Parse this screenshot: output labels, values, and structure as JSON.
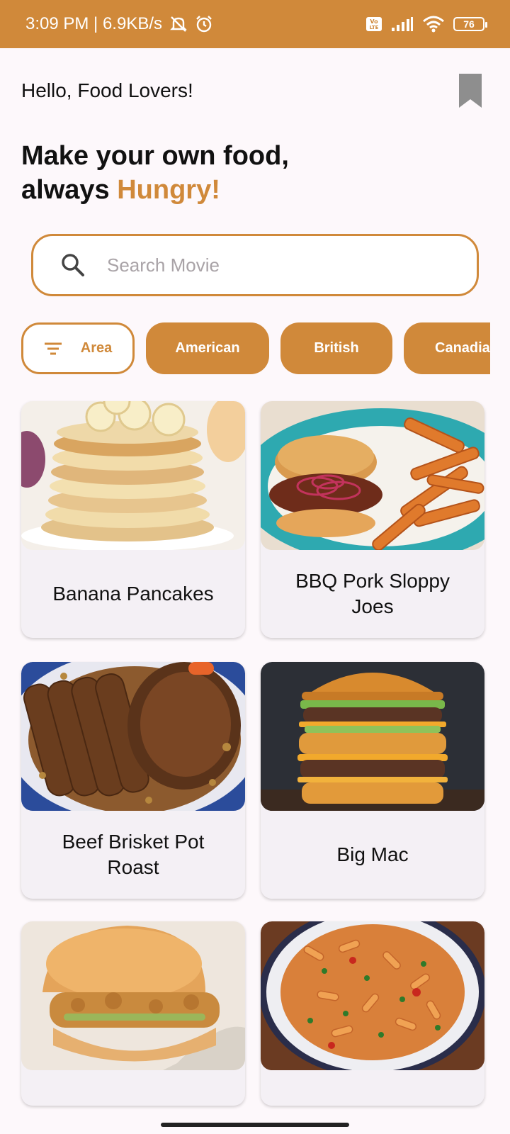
{
  "status_bar": {
    "time_speed": "3:09 PM | 6.9KB/s",
    "battery": "76",
    "icons": [
      "mute-icon",
      "alarm-icon",
      "volte-icon",
      "signal-icon",
      "wifi-icon",
      "battery-icon"
    ]
  },
  "header": {
    "greeting": "Hello, Food Lovers!",
    "headline_line1": "Make your own food,",
    "headline_line2_prefix": "always ",
    "headline_accent": "Hungry!"
  },
  "search": {
    "placeholder": "Search Movie",
    "value": ""
  },
  "filters": {
    "filter_label": "Area",
    "chips": [
      "American",
      "British",
      "Canadian"
    ]
  },
  "meals": [
    {
      "name": "Banana Pancakes"
    },
    {
      "name": "BBQ Pork Sloppy Joes"
    },
    {
      "name": "Beef Brisket Pot Roast"
    },
    {
      "name": "Big Mac"
    },
    {
      "name": ""
    },
    {
      "name": ""
    }
  ],
  "colors": {
    "accent": "#d0893a",
    "background": "#fdf8fb",
    "card": "#f4f0f5"
  }
}
